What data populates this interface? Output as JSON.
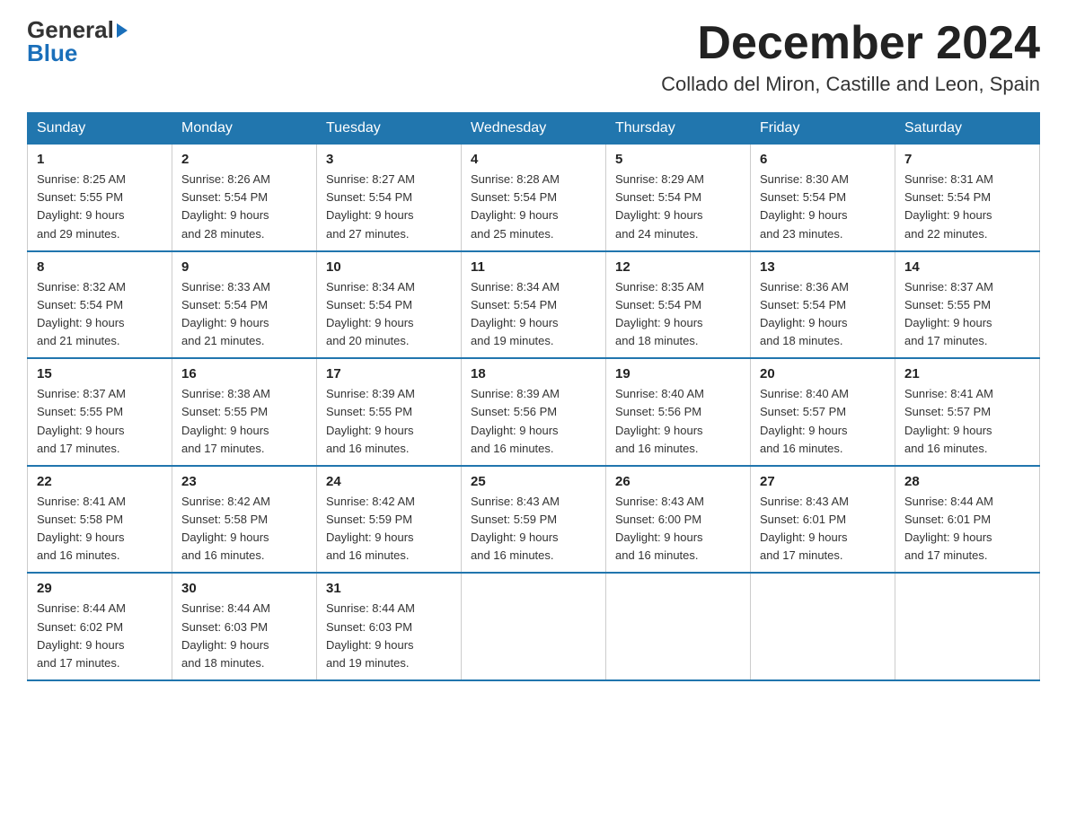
{
  "logo": {
    "general": "General",
    "blue": "Blue",
    "triangle": "▶"
  },
  "title": {
    "month": "December 2024",
    "location": "Collado del Miron, Castille and Leon, Spain"
  },
  "headers": [
    "Sunday",
    "Monday",
    "Tuesday",
    "Wednesday",
    "Thursday",
    "Friday",
    "Saturday"
  ],
  "weeks": [
    [
      {
        "day": "1",
        "sunrise": "8:25 AM",
        "sunset": "5:55 PM",
        "daylight": "9 hours and 29 minutes."
      },
      {
        "day": "2",
        "sunrise": "8:26 AM",
        "sunset": "5:54 PM",
        "daylight": "9 hours and 28 minutes."
      },
      {
        "day": "3",
        "sunrise": "8:27 AM",
        "sunset": "5:54 PM",
        "daylight": "9 hours and 27 minutes."
      },
      {
        "day": "4",
        "sunrise": "8:28 AM",
        "sunset": "5:54 PM",
        "daylight": "9 hours and 25 minutes."
      },
      {
        "day": "5",
        "sunrise": "8:29 AM",
        "sunset": "5:54 PM",
        "daylight": "9 hours and 24 minutes."
      },
      {
        "day": "6",
        "sunrise": "8:30 AM",
        "sunset": "5:54 PM",
        "daylight": "9 hours and 23 minutes."
      },
      {
        "day": "7",
        "sunrise": "8:31 AM",
        "sunset": "5:54 PM",
        "daylight": "9 hours and 22 minutes."
      }
    ],
    [
      {
        "day": "8",
        "sunrise": "8:32 AM",
        "sunset": "5:54 PM",
        "daylight": "9 hours and 21 minutes."
      },
      {
        "day": "9",
        "sunrise": "8:33 AM",
        "sunset": "5:54 PM",
        "daylight": "9 hours and 21 minutes."
      },
      {
        "day": "10",
        "sunrise": "8:34 AM",
        "sunset": "5:54 PM",
        "daylight": "9 hours and 20 minutes."
      },
      {
        "day": "11",
        "sunrise": "8:34 AM",
        "sunset": "5:54 PM",
        "daylight": "9 hours and 19 minutes."
      },
      {
        "day": "12",
        "sunrise": "8:35 AM",
        "sunset": "5:54 PM",
        "daylight": "9 hours and 18 minutes."
      },
      {
        "day": "13",
        "sunrise": "8:36 AM",
        "sunset": "5:54 PM",
        "daylight": "9 hours and 18 minutes."
      },
      {
        "day": "14",
        "sunrise": "8:37 AM",
        "sunset": "5:55 PM",
        "daylight": "9 hours and 17 minutes."
      }
    ],
    [
      {
        "day": "15",
        "sunrise": "8:37 AM",
        "sunset": "5:55 PM",
        "daylight": "9 hours and 17 minutes."
      },
      {
        "day": "16",
        "sunrise": "8:38 AM",
        "sunset": "5:55 PM",
        "daylight": "9 hours and 17 minutes."
      },
      {
        "day": "17",
        "sunrise": "8:39 AM",
        "sunset": "5:55 PM",
        "daylight": "9 hours and 16 minutes."
      },
      {
        "day": "18",
        "sunrise": "8:39 AM",
        "sunset": "5:56 PM",
        "daylight": "9 hours and 16 minutes."
      },
      {
        "day": "19",
        "sunrise": "8:40 AM",
        "sunset": "5:56 PM",
        "daylight": "9 hours and 16 minutes."
      },
      {
        "day": "20",
        "sunrise": "8:40 AM",
        "sunset": "5:57 PM",
        "daylight": "9 hours and 16 minutes."
      },
      {
        "day": "21",
        "sunrise": "8:41 AM",
        "sunset": "5:57 PM",
        "daylight": "9 hours and 16 minutes."
      }
    ],
    [
      {
        "day": "22",
        "sunrise": "8:41 AM",
        "sunset": "5:58 PM",
        "daylight": "9 hours and 16 minutes."
      },
      {
        "day": "23",
        "sunrise": "8:42 AM",
        "sunset": "5:58 PM",
        "daylight": "9 hours and 16 minutes."
      },
      {
        "day": "24",
        "sunrise": "8:42 AM",
        "sunset": "5:59 PM",
        "daylight": "9 hours and 16 minutes."
      },
      {
        "day": "25",
        "sunrise": "8:43 AM",
        "sunset": "5:59 PM",
        "daylight": "9 hours and 16 minutes."
      },
      {
        "day": "26",
        "sunrise": "8:43 AM",
        "sunset": "6:00 PM",
        "daylight": "9 hours and 16 minutes."
      },
      {
        "day": "27",
        "sunrise": "8:43 AM",
        "sunset": "6:01 PM",
        "daylight": "9 hours and 17 minutes."
      },
      {
        "day": "28",
        "sunrise": "8:44 AM",
        "sunset": "6:01 PM",
        "daylight": "9 hours and 17 minutes."
      }
    ],
    [
      {
        "day": "29",
        "sunrise": "8:44 AM",
        "sunset": "6:02 PM",
        "daylight": "9 hours and 17 minutes."
      },
      {
        "day": "30",
        "sunrise": "8:44 AM",
        "sunset": "6:03 PM",
        "daylight": "9 hours and 18 minutes."
      },
      {
        "day": "31",
        "sunrise": "8:44 AM",
        "sunset": "6:03 PM",
        "daylight": "9 hours and 19 minutes."
      },
      null,
      null,
      null,
      null
    ]
  ]
}
